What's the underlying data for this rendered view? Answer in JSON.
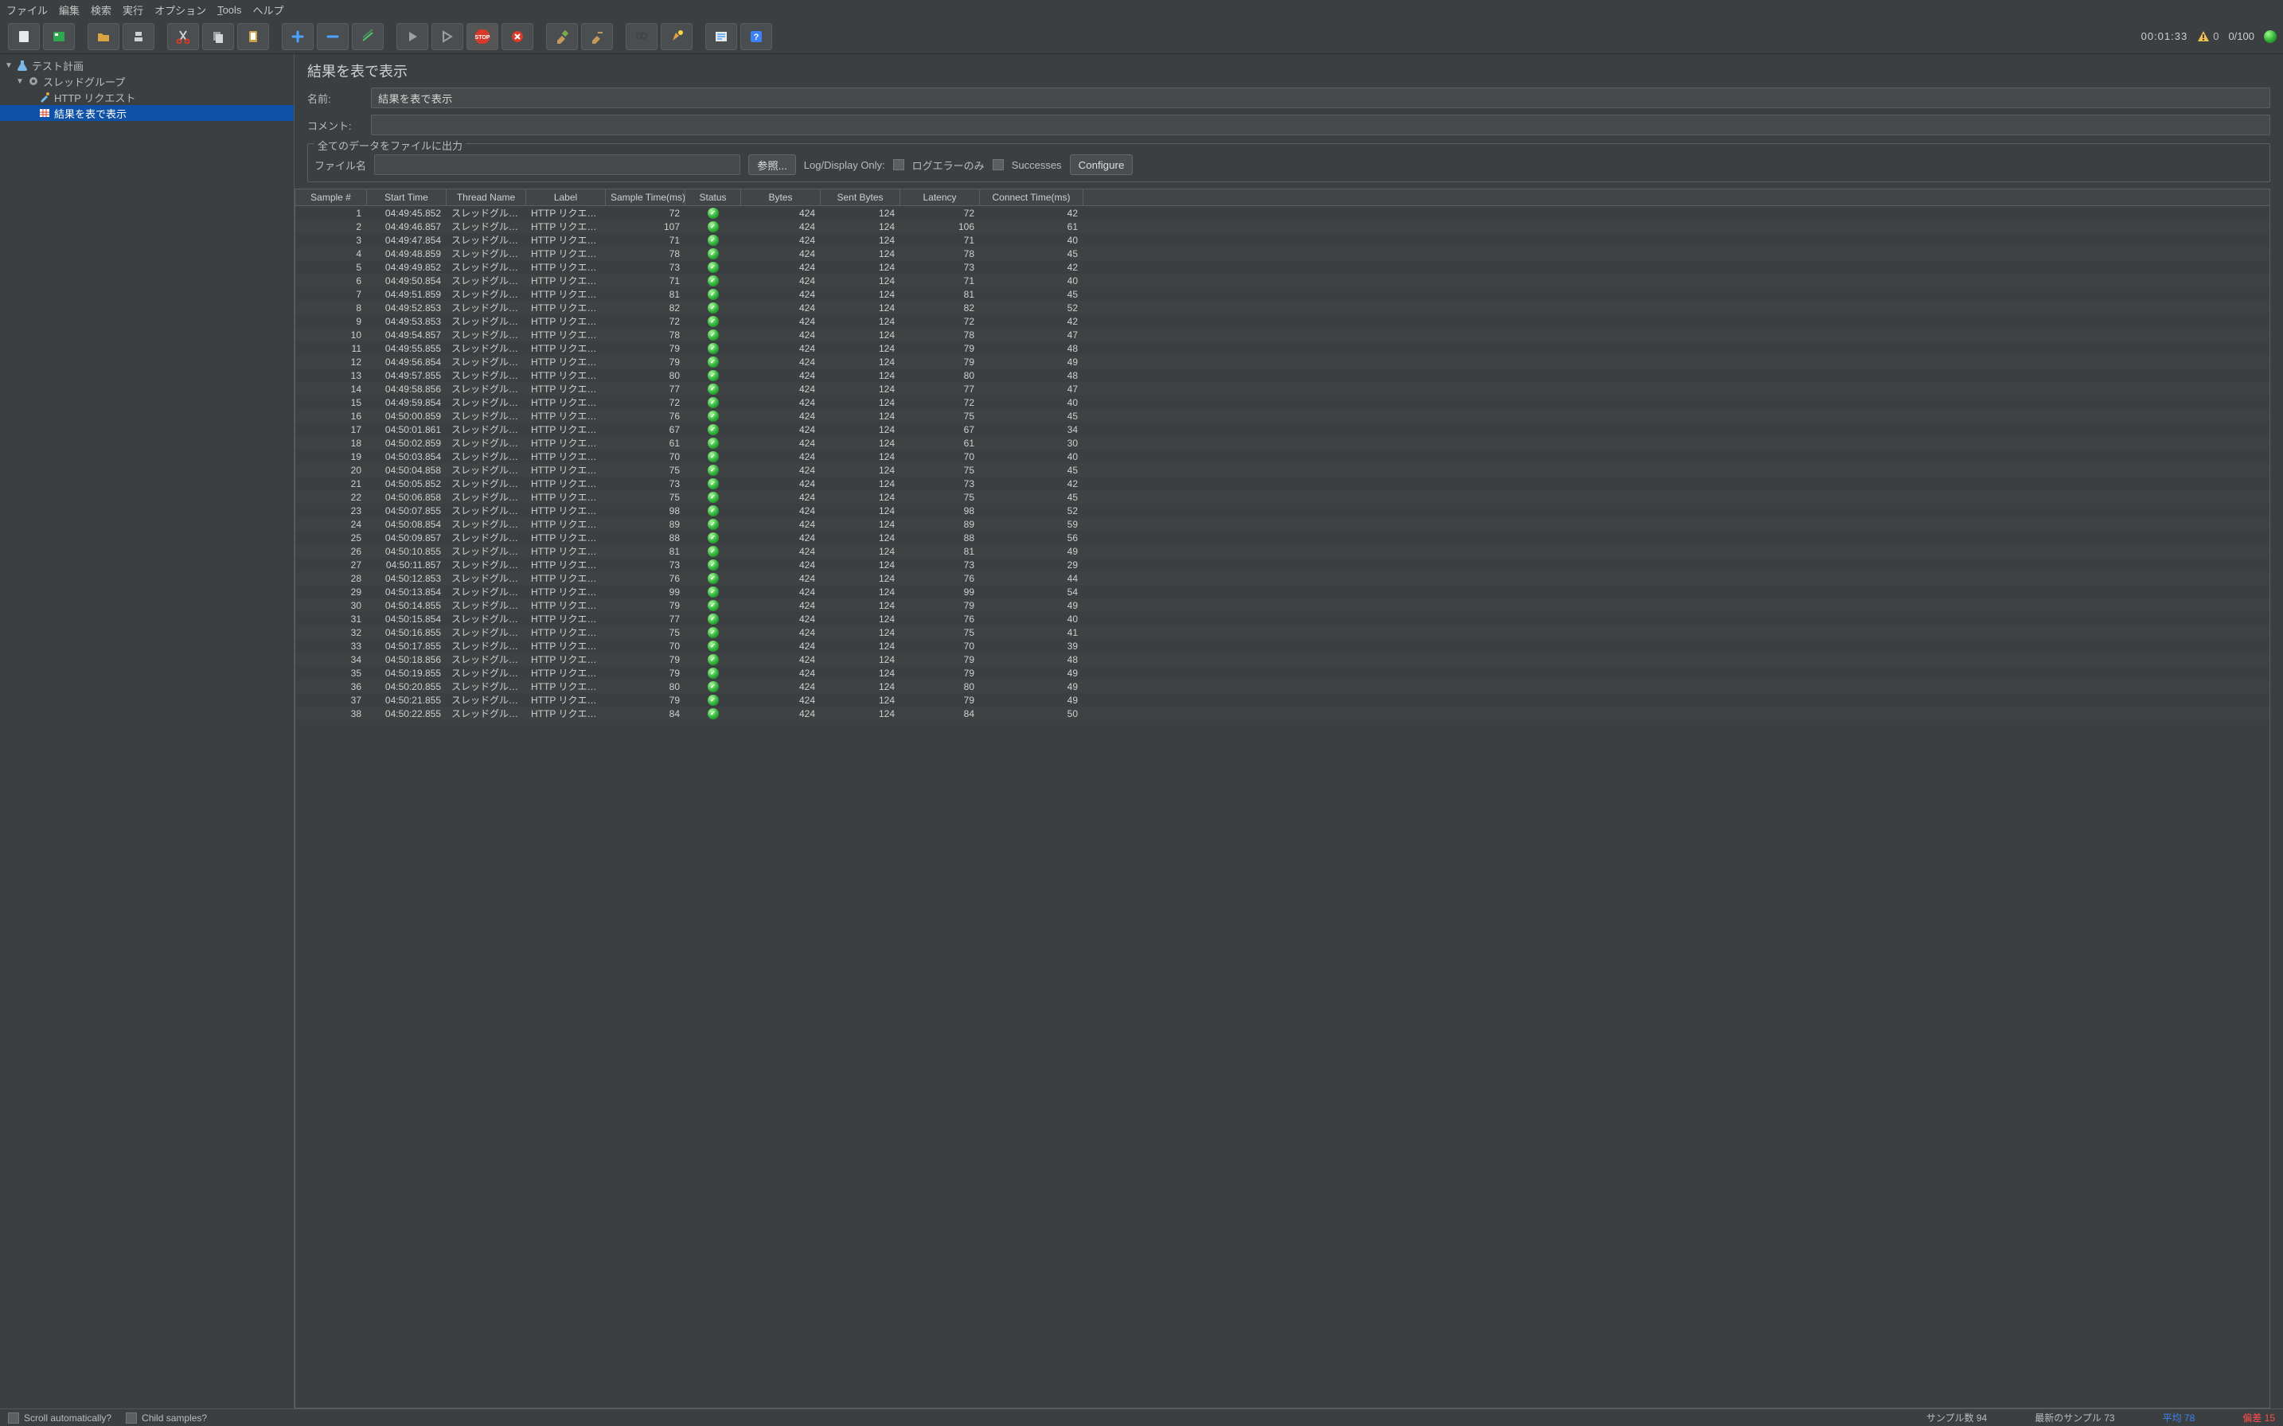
{
  "menu": [
    "ファイル",
    "編集",
    "検索",
    "実行",
    "オプション",
    "Tools",
    "ヘルプ"
  ],
  "timer": "00:01:33",
  "warn_count": "0",
  "thread_ratio": "0/100",
  "tree": {
    "root": "テスト計画",
    "group": "スレッドグループ",
    "http": "HTTP リクエスト",
    "listener": "結果を表で表示"
  },
  "panel": {
    "title": "結果を表で表示",
    "name_label": "名前:",
    "name_value": "結果を表で表示",
    "comment_label": "コメント:",
    "filebox_legend": "全てのデータをファイルに出力",
    "filename_label": "ファイル名",
    "browse": "参照...",
    "logonly": "Log/Display Only:",
    "chk1": "ログエラーのみ",
    "chk2": "Successes",
    "configure": "Configure"
  },
  "cols": [
    "Sample #",
    "Start Time",
    "Thread Name",
    "Label",
    "Sample Time(ms)",
    "Status",
    "Bytes",
    "Sent Bytes",
    "Latency",
    "Connect Time(ms)"
  ],
  "rows": [
    {
      "n": 1,
      "t": "04:49:45.852",
      "th": "スレッドグル―...",
      "l": "HTTP リクエスト",
      "st": 72,
      "b": 424,
      "sb": 124,
      "la": 72,
      "ct": 42
    },
    {
      "n": 2,
      "t": "04:49:46.857",
      "th": "スレッドグル―...",
      "l": "HTTP リクエスト",
      "st": 107,
      "b": 424,
      "sb": 124,
      "la": 106,
      "ct": 61
    },
    {
      "n": 3,
      "t": "04:49:47.854",
      "th": "スレッドグル―...",
      "l": "HTTP リクエスト",
      "st": 71,
      "b": 424,
      "sb": 124,
      "la": 71,
      "ct": 40
    },
    {
      "n": 4,
      "t": "04:49:48.859",
      "th": "スレッドグル―...",
      "l": "HTTP リクエスト",
      "st": 78,
      "b": 424,
      "sb": 124,
      "la": 78,
      "ct": 45
    },
    {
      "n": 5,
      "t": "04:49:49.852",
      "th": "スレッドグル―...",
      "l": "HTTP リクエスト",
      "st": 73,
      "b": 424,
      "sb": 124,
      "la": 73,
      "ct": 42
    },
    {
      "n": 6,
      "t": "04:49:50.854",
      "th": "スレッドグル―...",
      "l": "HTTP リクエスト",
      "st": 71,
      "b": 424,
      "sb": 124,
      "la": 71,
      "ct": 40
    },
    {
      "n": 7,
      "t": "04:49:51.859",
      "th": "スレッドグル―...",
      "l": "HTTP リクエスト",
      "st": 81,
      "b": 424,
      "sb": 124,
      "la": 81,
      "ct": 45
    },
    {
      "n": 8,
      "t": "04:49:52.853",
      "th": "スレッドグル―...",
      "l": "HTTP リクエスト",
      "st": 82,
      "b": 424,
      "sb": 124,
      "la": 82,
      "ct": 52
    },
    {
      "n": 9,
      "t": "04:49:53.853",
      "th": "スレッドグル―...",
      "l": "HTTP リクエスト",
      "st": 72,
      "b": 424,
      "sb": 124,
      "la": 72,
      "ct": 42
    },
    {
      "n": 10,
      "t": "04:49:54.857",
      "th": "スレッドグル―...",
      "l": "HTTP リクエスト",
      "st": 78,
      "b": 424,
      "sb": 124,
      "la": 78,
      "ct": 47
    },
    {
      "n": 11,
      "t": "04:49:55.855",
      "th": "スレッドグル―...",
      "l": "HTTP リクエスト",
      "st": 79,
      "b": 424,
      "sb": 124,
      "la": 79,
      "ct": 48
    },
    {
      "n": 12,
      "t": "04:49:56.854",
      "th": "スレッドグル―...",
      "l": "HTTP リクエスト",
      "st": 79,
      "b": 424,
      "sb": 124,
      "la": 79,
      "ct": 49
    },
    {
      "n": 13,
      "t": "04:49:57.855",
      "th": "スレッドグル―...",
      "l": "HTTP リクエスト",
      "st": 80,
      "b": 424,
      "sb": 124,
      "la": 80,
      "ct": 48
    },
    {
      "n": 14,
      "t": "04:49:58.856",
      "th": "スレッドグル―...",
      "l": "HTTP リクエスト",
      "st": 77,
      "b": 424,
      "sb": 124,
      "la": 77,
      "ct": 47
    },
    {
      "n": 15,
      "t": "04:49:59.854",
      "th": "スレッドグル―...",
      "l": "HTTP リクエスト",
      "st": 72,
      "b": 424,
      "sb": 124,
      "la": 72,
      "ct": 40
    },
    {
      "n": 16,
      "t": "04:50:00.859",
      "th": "スレッドグル―...",
      "l": "HTTP リクエスト",
      "st": 76,
      "b": 424,
      "sb": 124,
      "la": 75,
      "ct": 45
    },
    {
      "n": 17,
      "t": "04:50:01.861",
      "th": "スレッドグル―...",
      "l": "HTTP リクエスト",
      "st": 67,
      "b": 424,
      "sb": 124,
      "la": 67,
      "ct": 34
    },
    {
      "n": 18,
      "t": "04:50:02.859",
      "th": "スレッドグル―...",
      "l": "HTTP リクエスト",
      "st": 61,
      "b": 424,
      "sb": 124,
      "la": 61,
      "ct": 30
    },
    {
      "n": 19,
      "t": "04:50:03.854",
      "th": "スレッドグル―...",
      "l": "HTTP リクエスト",
      "st": 70,
      "b": 424,
      "sb": 124,
      "la": 70,
      "ct": 40
    },
    {
      "n": 20,
      "t": "04:50:04.858",
      "th": "スレッドグル―...",
      "l": "HTTP リクエスト",
      "st": 75,
      "b": 424,
      "sb": 124,
      "la": 75,
      "ct": 45
    },
    {
      "n": 21,
      "t": "04:50:05.852",
      "th": "スレッドグル―...",
      "l": "HTTP リクエスト",
      "st": 73,
      "b": 424,
      "sb": 124,
      "la": 73,
      "ct": 42
    },
    {
      "n": 22,
      "t": "04:50:06.858",
      "th": "スレッドグル―...",
      "l": "HTTP リクエスト",
      "st": 75,
      "b": 424,
      "sb": 124,
      "la": 75,
      "ct": 45
    },
    {
      "n": 23,
      "t": "04:50:07.855",
      "th": "スレッドグル―...",
      "l": "HTTP リクエスト",
      "st": 98,
      "b": 424,
      "sb": 124,
      "la": 98,
      "ct": 52
    },
    {
      "n": 24,
      "t": "04:50:08.854",
      "th": "スレッドグル―...",
      "l": "HTTP リクエスト",
      "st": 89,
      "b": 424,
      "sb": 124,
      "la": 89,
      "ct": 59
    },
    {
      "n": 25,
      "t": "04:50:09.857",
      "th": "スレッドグル―...",
      "l": "HTTP リクエスト",
      "st": 88,
      "b": 424,
      "sb": 124,
      "la": 88,
      "ct": 56
    },
    {
      "n": 26,
      "t": "04:50:10.855",
      "th": "スレッドグル―...",
      "l": "HTTP リクエスト",
      "st": 81,
      "b": 424,
      "sb": 124,
      "la": 81,
      "ct": 49
    },
    {
      "n": 27,
      "t": "04:50:11.857",
      "th": "スレッドグル―...",
      "l": "HTTP リクエスト",
      "st": 73,
      "b": 424,
      "sb": 124,
      "la": 73,
      "ct": 29
    },
    {
      "n": 28,
      "t": "04:50:12.853",
      "th": "スレッドグル―...",
      "l": "HTTP リクエスト",
      "st": 76,
      "b": 424,
      "sb": 124,
      "la": 76,
      "ct": 44
    },
    {
      "n": 29,
      "t": "04:50:13.854",
      "th": "スレッドグル―...",
      "l": "HTTP リクエスト",
      "st": 99,
      "b": 424,
      "sb": 124,
      "la": 99,
      "ct": 54
    },
    {
      "n": 30,
      "t": "04:50:14.855",
      "th": "スレッドグル―...",
      "l": "HTTP リクエスト",
      "st": 79,
      "b": 424,
      "sb": 124,
      "la": 79,
      "ct": 49
    },
    {
      "n": 31,
      "t": "04:50:15.854",
      "th": "スレッドグル―...",
      "l": "HTTP リクエスト",
      "st": 77,
      "b": 424,
      "sb": 124,
      "la": 76,
      "ct": 40
    },
    {
      "n": 32,
      "t": "04:50:16.855",
      "th": "スレッドグル―...",
      "l": "HTTP リクエスト",
      "st": 75,
      "b": 424,
      "sb": 124,
      "la": 75,
      "ct": 41
    },
    {
      "n": 33,
      "t": "04:50:17.855",
      "th": "スレッドグル―...",
      "l": "HTTP リクエスト",
      "st": 70,
      "b": 424,
      "sb": 124,
      "la": 70,
      "ct": 39
    },
    {
      "n": 34,
      "t": "04:50:18.856",
      "th": "スレッドグル―...",
      "l": "HTTP リクエスト",
      "st": 79,
      "b": 424,
      "sb": 124,
      "la": 79,
      "ct": 48
    },
    {
      "n": 35,
      "t": "04:50:19.855",
      "th": "スレッドグル―...",
      "l": "HTTP リクエスト",
      "st": 79,
      "b": 424,
      "sb": 124,
      "la": 79,
      "ct": 49
    },
    {
      "n": 36,
      "t": "04:50:20.855",
      "th": "スレッドグル―...",
      "l": "HTTP リクエスト",
      "st": 80,
      "b": 424,
      "sb": 124,
      "la": 80,
      "ct": 49
    },
    {
      "n": 37,
      "t": "04:50:21.855",
      "th": "スレッドグル―...",
      "l": "HTTP リクエスト",
      "st": 79,
      "b": 424,
      "sb": 124,
      "la": 79,
      "ct": 49
    },
    {
      "n": 38,
      "t": "04:50:22.855",
      "th": "スレッドグル―...",
      "l": "HTTP リクエスト",
      "st": 84,
      "b": 424,
      "sb": 124,
      "la": 84,
      "ct": 50
    }
  ],
  "status": {
    "scroll": "Scroll automatically?",
    "child": "Child samples?",
    "samples_label": "サンプル数",
    "samples": "94",
    "latest_label": "最新のサンプル",
    "latest": "73",
    "avg_label": "平均",
    "avg": "78",
    "dev_label": "偏差",
    "dev": "15"
  }
}
